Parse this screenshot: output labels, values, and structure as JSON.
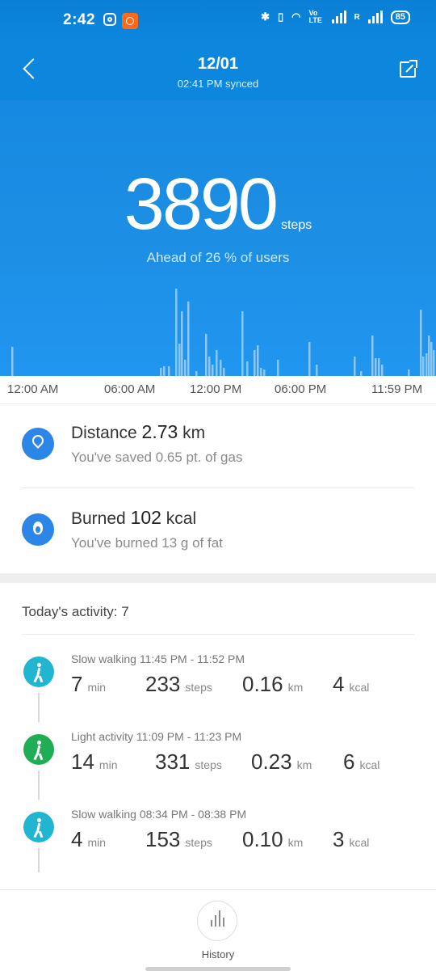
{
  "status_bar": {
    "time": "2:42",
    "battery": "85",
    "network_label": "Vo LTE",
    "roaming": "R"
  },
  "header": {
    "date": "12/01",
    "synced": "02:41 PM synced"
  },
  "summary": {
    "steps": "3890",
    "steps_unit": "steps",
    "rank_text": "Ahead of 26 % of users"
  },
  "chart_data": {
    "type": "bar",
    "x_range": [
      "12:00 AM",
      "11:59 PM"
    ],
    "x_ticks": [
      "12:00 AM",
      "06:00 AM",
      "12:00 PM",
      "06:00 PM",
      "11:59 PM"
    ],
    "grid": false,
    "legend": "none",
    "bar_color": "#8cc7f4",
    "ylim": [
      0,
      110
    ],
    "bars": [
      {
        "t": 14,
        "v": 36
      },
      {
        "t": 198,
        "v": 10
      },
      {
        "t": 202,
        "v": 12
      },
      {
        "t": 208,
        "v": 12
      },
      {
        "t": 217,
        "v": 108
      },
      {
        "t": 221,
        "v": 40
      },
      {
        "t": 224,
        "v": 80
      },
      {
        "t": 228,
        "v": 20
      },
      {
        "t": 232,
        "v": 92
      },
      {
        "t": 242,
        "v": 6
      },
      {
        "t": 254,
        "v": 52
      },
      {
        "t": 258,
        "v": 24
      },
      {
        "t": 262,
        "v": 14
      },
      {
        "t": 267,
        "v": 32
      },
      {
        "t": 272,
        "v": 20
      },
      {
        "t": 276,
        "v": 10
      },
      {
        "t": 299,
        "v": 80
      },
      {
        "t": 305,
        "v": 18
      },
      {
        "t": 314,
        "v": 32
      },
      {
        "t": 318,
        "v": 38
      },
      {
        "t": 322,
        "v": 10
      },
      {
        "t": 326,
        "v": 8
      },
      {
        "t": 343,
        "v": 20
      },
      {
        "t": 382,
        "v": 42
      },
      {
        "t": 391,
        "v": 14
      },
      {
        "t": 438,
        "v": 24
      },
      {
        "t": 446,
        "v": 6
      },
      {
        "t": 460,
        "v": 50
      },
      {
        "t": 464,
        "v": 22
      },
      {
        "t": 468,
        "v": 22
      },
      {
        "t": 472,
        "v": 14
      },
      {
        "t": 505,
        "v": 8
      },
      {
        "t": 520,
        "v": 82
      },
      {
        "t": 523,
        "v": 24
      },
      {
        "t": 527,
        "v": 28
      },
      {
        "t": 530,
        "v": 50
      },
      {
        "t": 533,
        "v": 42
      },
      {
        "t": 536,
        "v": 32
      }
    ]
  },
  "distance": {
    "label": "Distance",
    "value": "2.73",
    "unit": "km",
    "sub": "You've saved 0.65 pt.  of gas"
  },
  "burned": {
    "label": "Burned",
    "value": "102",
    "unit": "kcal",
    "sub": "You've burned 13 g  of fat"
  },
  "activity": {
    "header": "Today's activity:  7",
    "items": [
      {
        "title": "Slow walking 11:45 PM - 11:52 PM",
        "min": "7",
        "steps": "233",
        "km": "0.16",
        "kcal": "4",
        "color": "#21b5cf"
      },
      {
        "title": "Light activity 11:09 PM - 11:23 PM",
        "min": "14",
        "steps": "331",
        "km": "0.23",
        "kcal": "6",
        "color": "#1fae55"
      },
      {
        "title": "Slow walking 08:34 PM - 08:38 PM",
        "min": "4",
        "steps": "153",
        "km": "0.10",
        "kcal": "3",
        "color": "#21b5cf"
      }
    ],
    "units": {
      "min": "min",
      "steps": "steps",
      "km": "km",
      "kcal": "kcal"
    }
  },
  "bottom": {
    "history_label": "History"
  }
}
